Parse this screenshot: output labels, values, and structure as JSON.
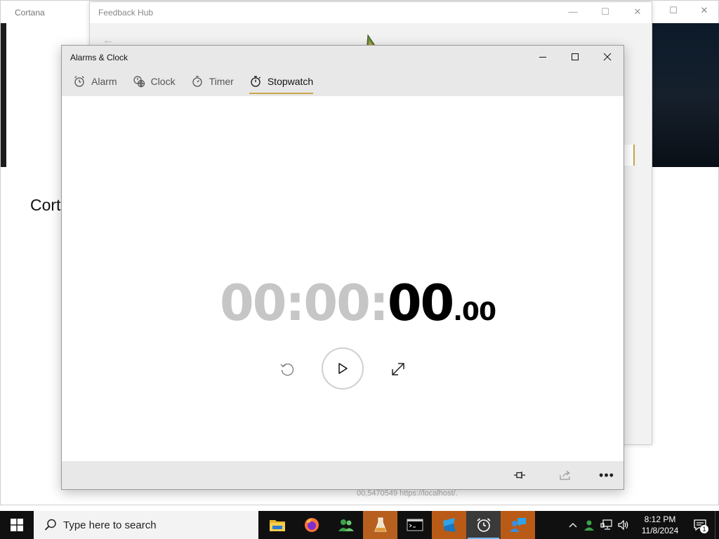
{
  "background": {
    "cortana": {
      "title": "Cortana",
      "heading": "Cort"
    },
    "feedback_hub": {
      "title": "Feedback Hub"
    },
    "status_text": "00,5470549 https://localhost/."
  },
  "alarms_clock": {
    "title": "Alarms & Clock",
    "tabs": [
      {
        "label": "Alarm",
        "icon": "alarm-icon"
      },
      {
        "label": "Clock",
        "icon": "world-clock-icon"
      },
      {
        "label": "Timer",
        "icon": "timer-icon"
      },
      {
        "label": "Stopwatch",
        "icon": "stopwatch-icon",
        "active": true
      }
    ],
    "stopwatch": {
      "hours": "00:",
      "minutes": "00:",
      "seconds": "00",
      "fraction": ".00"
    }
  },
  "taskbar": {
    "search_placeholder": "Type here to search",
    "time": "8:12 PM",
    "date": "11/8/2024",
    "notification_count": "1",
    "apps": [
      "file-explorer-icon",
      "firefox-icon",
      "people-icon",
      "lab-flask-icon",
      "terminal-icon",
      "app-blue-icon",
      "alarms-clock-icon",
      "feedback-hub-icon"
    ]
  },
  "colors": {
    "accent": "#c8a64a",
    "taskbar_bg": "#101010",
    "highlight_orange": "#b65f1f"
  }
}
